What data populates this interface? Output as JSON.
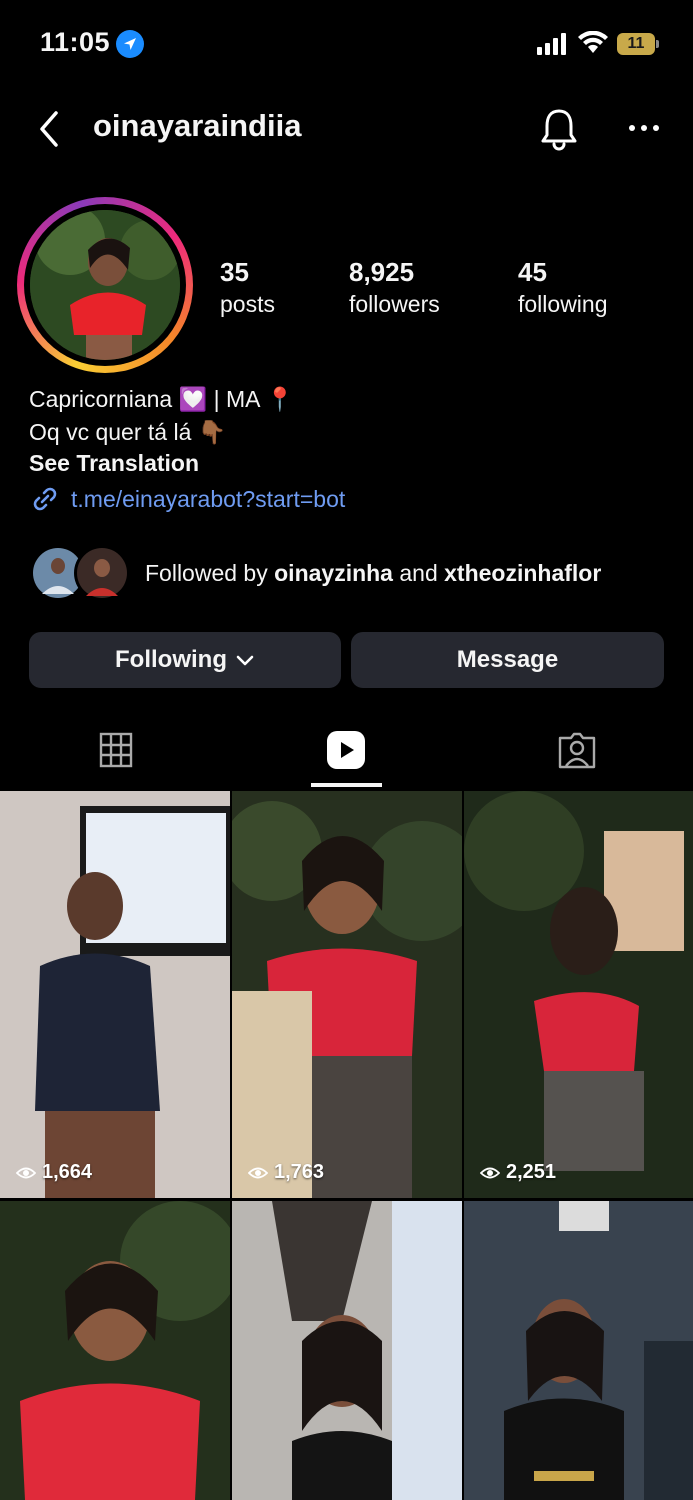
{
  "status_bar": {
    "time": "11:05",
    "battery": "11"
  },
  "header": {
    "username": "oinayaraindiia"
  },
  "stats": [
    {
      "value": "35",
      "label": "posts"
    },
    {
      "value": "8,925",
      "label": "followers"
    },
    {
      "value": "45",
      "label": "following"
    }
  ],
  "bio": {
    "line1_text": "Capricorniana",
    "line1_emoji": "💟",
    "line1_rest": "| MA",
    "line1_emoji2": "📍",
    "line2_text": "Oq vc quer tá lá",
    "line2_emoji": "👇🏾",
    "see_translation": "See Translation",
    "link": "t.me/einayarabot?start=bot"
  },
  "followed_by": {
    "prefix": "Followed by",
    "user1": "oinayzinha",
    "conjunction": "and",
    "user2": "xtheozinhaflor"
  },
  "buttons": {
    "following": "Following",
    "message": "Message"
  },
  "tabs": [
    "grid-icon",
    "reels-icon",
    "tagged-icon"
  ],
  "reels": [
    {
      "views": "1,664"
    },
    {
      "views": "1,763"
    },
    {
      "views": "2,251"
    },
    {
      "views": ""
    },
    {
      "views": ""
    },
    {
      "views": ""
    }
  ],
  "colors": {
    "background": "#000000",
    "button_bg": "#262830",
    "link": "#6f9cf2",
    "location_blue": "#1a8cff"
  }
}
